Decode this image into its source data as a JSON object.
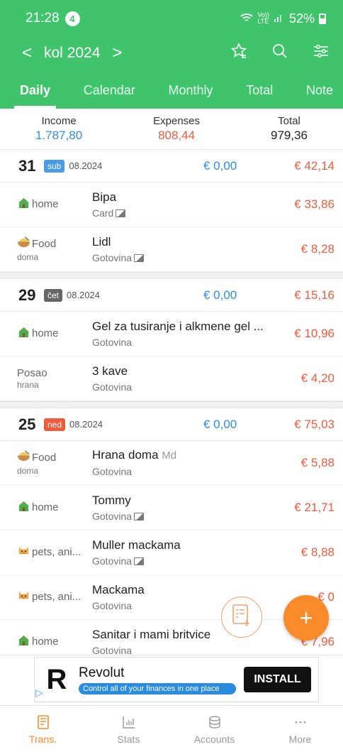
{
  "status": {
    "time": "21:28",
    "notif_count": "4",
    "net_top": "Vo))",
    "net_bot": "LTE",
    "battery": "52%"
  },
  "nav": {
    "prev": "<",
    "month": "kol 2024",
    "next": ">"
  },
  "tabs": [
    {
      "label": "Daily",
      "active": true
    },
    {
      "label": "Calendar"
    },
    {
      "label": "Monthly"
    },
    {
      "label": "Total"
    },
    {
      "label": "Note"
    }
  ],
  "summary": {
    "income_label": "Income",
    "income": "1.787,80",
    "expenses_label": "Expenses",
    "expenses": "808,44",
    "total_label": "Total",
    "total": "979,36"
  },
  "days": [
    {
      "day": "31",
      "weekday": "sub",
      "weekday_color": "#4a9be5",
      "month_year": "08.2024",
      "income": "€ 0,00",
      "expense": "€ 42,14",
      "rows": [
        {
          "cat": "home",
          "icon": "house-icon",
          "sub": "",
          "title": "Bipa",
          "memo": "",
          "account": "Card",
          "has_photo": true,
          "amount": "€ 33,86"
        },
        {
          "cat": "Food",
          "icon": "food-bowl-icon",
          "sub": "doma",
          "title": "Lidl",
          "memo": "",
          "account": "Gotovina",
          "has_photo": true,
          "amount": "€ 8,28"
        }
      ]
    },
    {
      "day": "29",
      "weekday": "čet",
      "weekday_color": "#666666",
      "month_year": "08.2024",
      "income": "€ 0,00",
      "expense": "€ 15,16",
      "rows": [
        {
          "cat": "home",
          "icon": "house-icon",
          "sub": "",
          "title": "Gel za tusiranje i alkmene gel ...",
          "memo": "",
          "account": "Gotovina",
          "has_photo": false,
          "amount": "€ 10,96"
        },
        {
          "cat": "Posao",
          "icon": "",
          "sub": "hrana",
          "title": "3 kave",
          "memo": "",
          "account": "Gotovina",
          "has_photo": false,
          "amount": "€ 4,20"
        }
      ]
    },
    {
      "day": "25",
      "weekday": "ned",
      "weekday_color": "#ef5b3d",
      "month_year": "08.2024",
      "income": "€ 0,00",
      "expense": "€ 75,03",
      "rows": [
        {
          "cat": "Food",
          "icon": "food-bowl-icon",
          "sub": "doma",
          "title": "Hrana doma",
          "memo": "Md",
          "account": "Gotovina",
          "has_photo": false,
          "amount": "€ 5,88"
        },
        {
          "cat": "home",
          "icon": "house-icon",
          "sub": "",
          "title": "Tommy",
          "memo": "",
          "account": "Gotovina",
          "has_photo": true,
          "amount": "€ 21,71"
        },
        {
          "cat": "pets, ani...",
          "icon": "cat-face-icon",
          "sub": "",
          "title": "Muller mackama",
          "memo": "",
          "account": "Gotovina",
          "has_photo": true,
          "amount": "€ 8,88"
        },
        {
          "cat": "pets, ani...",
          "icon": "cat-face-icon",
          "sub": "",
          "title": "Mackama",
          "memo": "",
          "account": "Gotovina",
          "has_photo": false,
          "amount": "€ 0"
        },
        {
          "cat": "home",
          "icon": "house-icon",
          "sub": "",
          "title": "Sanitar i mami britvice",
          "memo": "",
          "account": "Gotovina",
          "has_photo": false,
          "amount": "€ 7,96"
        }
      ]
    }
  ],
  "ad": {
    "name": "Revolut",
    "tagline": "Control all of your finances in one place",
    "button": "INSTALL",
    "logo": "R"
  },
  "bottom_nav": [
    {
      "label": "Trans.",
      "icon": "ledger-icon",
      "active": true
    },
    {
      "label": "Stats",
      "icon": "bar-chart-icon"
    },
    {
      "label": "Accounts",
      "icon": "coins-icon"
    },
    {
      "label": "More",
      "icon": "more-dots-icon"
    }
  ],
  "fab": {
    "plus": "+"
  },
  "colors": {
    "brand": "#3fc46c",
    "income": "#2f8ee0",
    "expense": "#ef5b3d",
    "accent": "#f98b2a"
  }
}
